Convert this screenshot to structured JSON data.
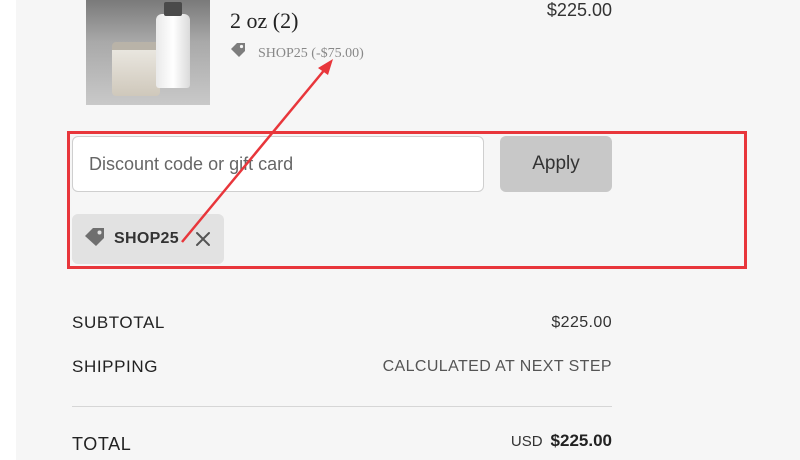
{
  "product": {
    "variant": "2 oz (2)",
    "discount_text": "SHOP25 (-$75.00)",
    "price": "$225.00",
    "image_icon": "product-photo",
    "tag_icon": "tag-icon"
  },
  "discount": {
    "placeholder": "Discount code or gift card",
    "apply_label": "Apply",
    "applied_code": "SHOP25",
    "remove_icon": "close-icon"
  },
  "summary": {
    "subtotal_label": "SUBTOTAL",
    "subtotal_value": "$225.00",
    "shipping_label": "SHIPPING",
    "shipping_value": "CALCULATED AT NEXT STEP",
    "total_label": "TOTAL",
    "total_currency": "USD",
    "total_value": "$225.00"
  },
  "colors": {
    "annotation": "#e8363b",
    "panel_bg": "#f6f6f6",
    "button_bg": "#c8c8c8"
  }
}
